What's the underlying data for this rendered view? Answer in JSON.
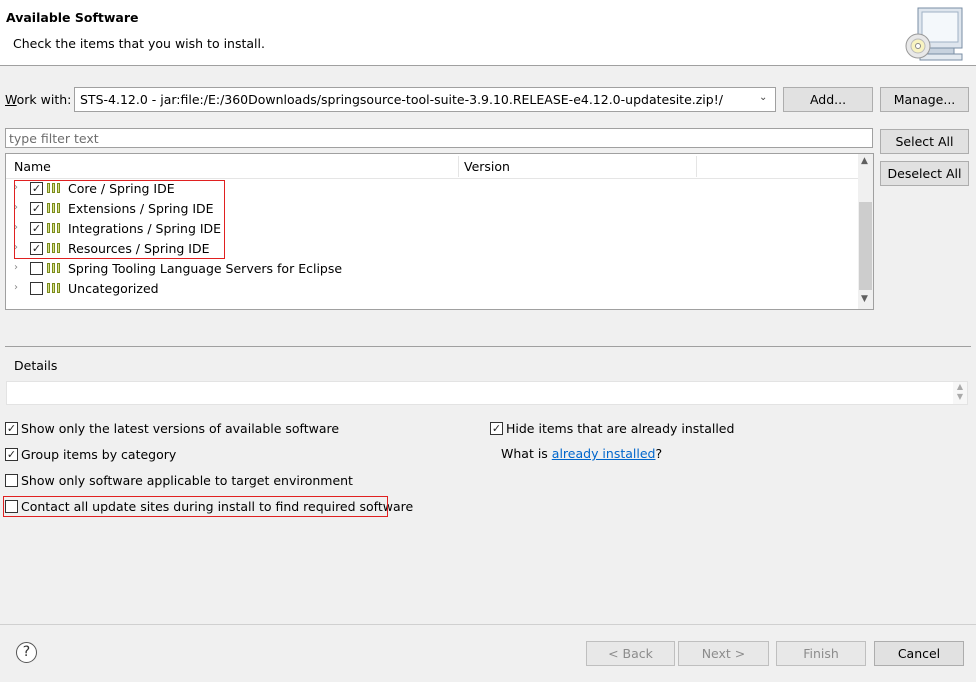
{
  "header": {
    "title": "Available Software",
    "subtitle": "Check the items that you wish to install."
  },
  "work_with": {
    "label": "Work with:",
    "value": "STS-4.12.0 - jar:file:/E:/360Downloads/springsource-tool-suite-3.9.10.RELEASE-e4.12.0-updatesite.zip!/",
    "add_label": "Add...",
    "manage_label": "Manage..."
  },
  "filter": {
    "placeholder": "type filter text"
  },
  "buttons": {
    "select_all": "Select All",
    "deselect_all": "Deselect All"
  },
  "tree": {
    "columns": [
      "Name",
      "Version"
    ],
    "items": [
      {
        "label": "Core / Spring IDE",
        "checked": true
      },
      {
        "label": "Extensions / Spring IDE",
        "checked": true
      },
      {
        "label": "Integrations / Spring IDE",
        "checked": true
      },
      {
        "label": "Resources / Spring IDE",
        "checked": true
      },
      {
        "label": "Spring Tooling Language Servers for Eclipse",
        "checked": false
      },
      {
        "label": "Uncategorized",
        "checked": false
      }
    ]
  },
  "details": {
    "label": "Details"
  },
  "options": {
    "latest_versions": {
      "label": "Show only the latest versions of available software",
      "checked": true
    },
    "hide_installed": {
      "label": "Hide items that are already installed",
      "checked": true
    },
    "group_by_category": {
      "label": "Group items by category",
      "checked": true
    },
    "applicable_only": {
      "label": "Show only software applicable to target environment",
      "checked": false
    },
    "contact_sites": {
      "label": "Contact all update sites during install to find required software",
      "checked": false
    },
    "what_is_prefix": "What is ",
    "already_installed_link": "already installed",
    "what_is_suffix": "?"
  },
  "footer": {
    "back": "< Back",
    "next": "Next >",
    "finish": "Finish",
    "cancel": "Cancel",
    "help_glyph": "?"
  },
  "colors": {
    "highlight": "#e02020",
    "link": "#0066cc"
  }
}
